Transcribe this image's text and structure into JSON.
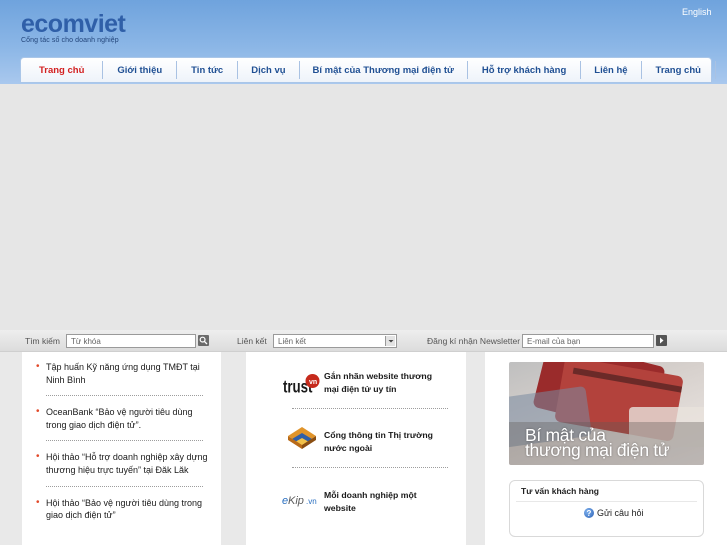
{
  "header": {
    "logo": "ecomviet",
    "tagline": "Cổng tác số cho doanh nghiệp",
    "language_link": "English"
  },
  "nav": {
    "items": [
      "Trang chủ",
      "Giới thiệu",
      "Tin tức",
      "Dịch vụ",
      "Bí mật của Thương mại điện tử",
      "Hỗ trợ khách hàng",
      "Liên hệ",
      "Trang chủ"
    ],
    "active_index": 0
  },
  "toolbar": {
    "search_label": "Tìm kiếm",
    "search_placeholder": "Từ khóa",
    "links_label": "Liên kết",
    "links_selected": "Liên kết",
    "newsletter_label": "Đăng kí nhận Newsletter",
    "email_placeholder": "E-mail của bạn"
  },
  "news": {
    "items": [
      "Tập huấn Kỹ năng ứng dụng TMĐT tại Ninh Bình",
      "OceanBank “Bảo vệ người tiêu dùng trong giao dịch điện tử”.",
      "Hội thảo “Hỗ trợ doanh nghiệp xây dựng thương hiệu trực tuyến” tại Đăk Lăk",
      "Hội thảo “Bảo vệ người tiêu dùng trong giao dịch điện tử”"
    ]
  },
  "services": {
    "items": [
      {
        "logo": "trust.vn",
        "text": "Gắn nhãn website thương mại điện tử uy tín"
      },
      {
        "logo": "portal",
        "text": "Cổng thông tin Thị trường nước ngoài"
      },
      {
        "logo": "eKip.vn",
        "text": "Mỗi doanh nghiệp một website"
      }
    ]
  },
  "promo": {
    "line1": "Bí mật của",
    "line2": "thương mại điện tử"
  },
  "support": {
    "title": "Tư vấn khách hàng",
    "ask_label": "Gửi câu hỏi"
  },
  "colors": {
    "header_blue": "#7fb0e3",
    "nav_text": "#1f4f93",
    "nav_active": "#d32020",
    "bullet": "#e24a2a"
  }
}
